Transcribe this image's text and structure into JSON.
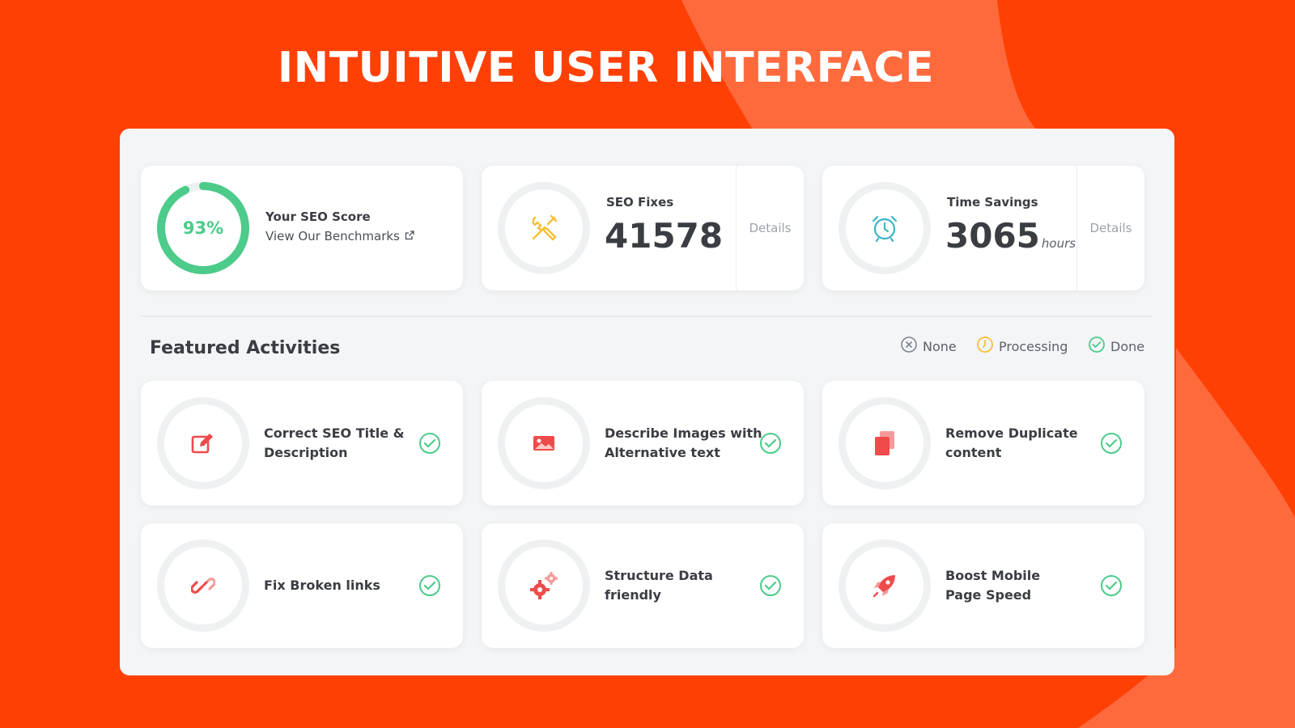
{
  "hero": {
    "title": "INTUITIVE USER INTERFACE"
  },
  "colors": {
    "background": "#ff4005",
    "accent_light": "#ff6a3d",
    "green": "#4ccb8a",
    "yellow": "#f7c034",
    "teal": "#3ab5c6",
    "red": "#ef4b4b"
  },
  "stats": {
    "seo_score": {
      "value": 0.93,
      "value_label": "93%",
      "title": "Your SEO Score",
      "link": "View Our Benchmarks",
      "icon": "external-link-icon"
    },
    "seo_fixes": {
      "title": "SEO Fixes",
      "value": "41578",
      "details": "Details",
      "icon": "tools-icon"
    },
    "time_savings": {
      "title": "Time Savings",
      "value": "3065",
      "unit": "hours",
      "details": "Details",
      "icon": "alarm-clock-icon"
    }
  },
  "activities": {
    "title": "Featured Activities",
    "legend": [
      {
        "label": "None",
        "icon": "x-circle-icon"
      },
      {
        "label": "Processing",
        "icon": "clock-circle-icon"
      },
      {
        "label": "Done",
        "icon": "check-circle-icon"
      }
    ],
    "items": [
      {
        "label": "Correct SEO Title & Description",
        "icon": "edit-icon",
        "status": "Done"
      },
      {
        "label": "Describe Images with Alternative text",
        "icon": "image-icon",
        "status": "Done"
      },
      {
        "label": "Remove Duplicate content",
        "icon": "copy-icon",
        "status": "Done"
      },
      {
        "label": "Fix Broken links",
        "icon": "link-icon",
        "status": "Done"
      },
      {
        "label": "Structure Data friendly",
        "icon": "gears-icon",
        "status": "Done"
      },
      {
        "label": "Boost Mobile Page Speed",
        "icon": "rocket-icon",
        "status": "Done"
      }
    ]
  }
}
